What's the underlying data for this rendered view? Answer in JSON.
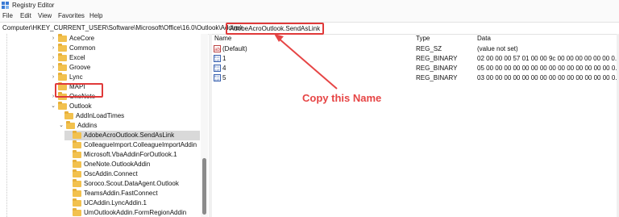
{
  "window": {
    "title": "Registry Editor"
  },
  "menu": [
    "File",
    "Edit",
    "View",
    "Favorites",
    "Help"
  ],
  "address": {
    "path": "Computer\\HKEY_CURRENT_USER\\Software\\Microsoft\\Office\\16.0\\Outlook\\Addins\\",
    "highlighted_key": "AdobeAcroOutlook.SendAsLink"
  },
  "tree": [
    {
      "label": "AceCore",
      "expander": "›"
    },
    {
      "label": "Common",
      "expander": "›"
    },
    {
      "label": "Excel",
      "expander": "›"
    },
    {
      "label": "Groove",
      "expander": "›"
    },
    {
      "label": "Lync",
      "expander": "›"
    },
    {
      "label": "MAPI",
      "expander": ""
    },
    {
      "label": "OneNote",
      "expander": "›"
    },
    {
      "label": "Outlook",
      "expander": "⌄"
    },
    {
      "label": "AddInLoadTimes",
      "expander": ""
    },
    {
      "label": "Addins",
      "expander": "⌄"
    },
    {
      "label": "AdobeAcroOutlook.SendAsLink",
      "expander": ""
    },
    {
      "label": "ColleagueImport.ColleagueImportAddin",
      "expander": ""
    },
    {
      "label": "Microsoft.VbaAddinForOutlook.1",
      "expander": ""
    },
    {
      "label": "OneNote.OutlookAddin",
      "expander": ""
    },
    {
      "label": "OscAddin.Connect",
      "expander": ""
    },
    {
      "label": "Soroco.Scout.DataAgent.Outlook",
      "expander": ""
    },
    {
      "label": "TeamsAddin.FastConnect",
      "expander": ""
    },
    {
      "label": "UCAddin.LyncAddin.1",
      "expander": ""
    },
    {
      "label": "UmOutlookAddin.FormRegionAddin",
      "expander": ""
    }
  ],
  "columns": {
    "name": "Name",
    "type": "Type",
    "data": "Data"
  },
  "values": [
    {
      "name": "(Default)",
      "type": "REG_SZ",
      "data": "(value not set)",
      "icon": "string-value-icon"
    },
    {
      "name": "1",
      "type": "REG_BINARY",
      "data": "02 00 00 00 57 01 00 00 9c 00 00 00 00 00 00 0...",
      "icon": "binary-value-icon"
    },
    {
      "name": "4",
      "type": "REG_BINARY",
      "data": "05 00 00 00 00 00 00 00 00 00 00 00 00 00 00 0...",
      "icon": "binary-value-icon"
    },
    {
      "name": "5",
      "type": "REG_BINARY",
      "data": "03 00 00 00 00 00 00 00 00 00 00 00 00 00 00 0...",
      "icon": "binary-value-icon"
    }
  ],
  "annotation": {
    "text": "Copy this Name",
    "color": "#e64545"
  },
  "colors": {
    "highlight_border": "#e03a3a",
    "folder": "#f2c14e",
    "selected_row": "#d9d9d9"
  }
}
